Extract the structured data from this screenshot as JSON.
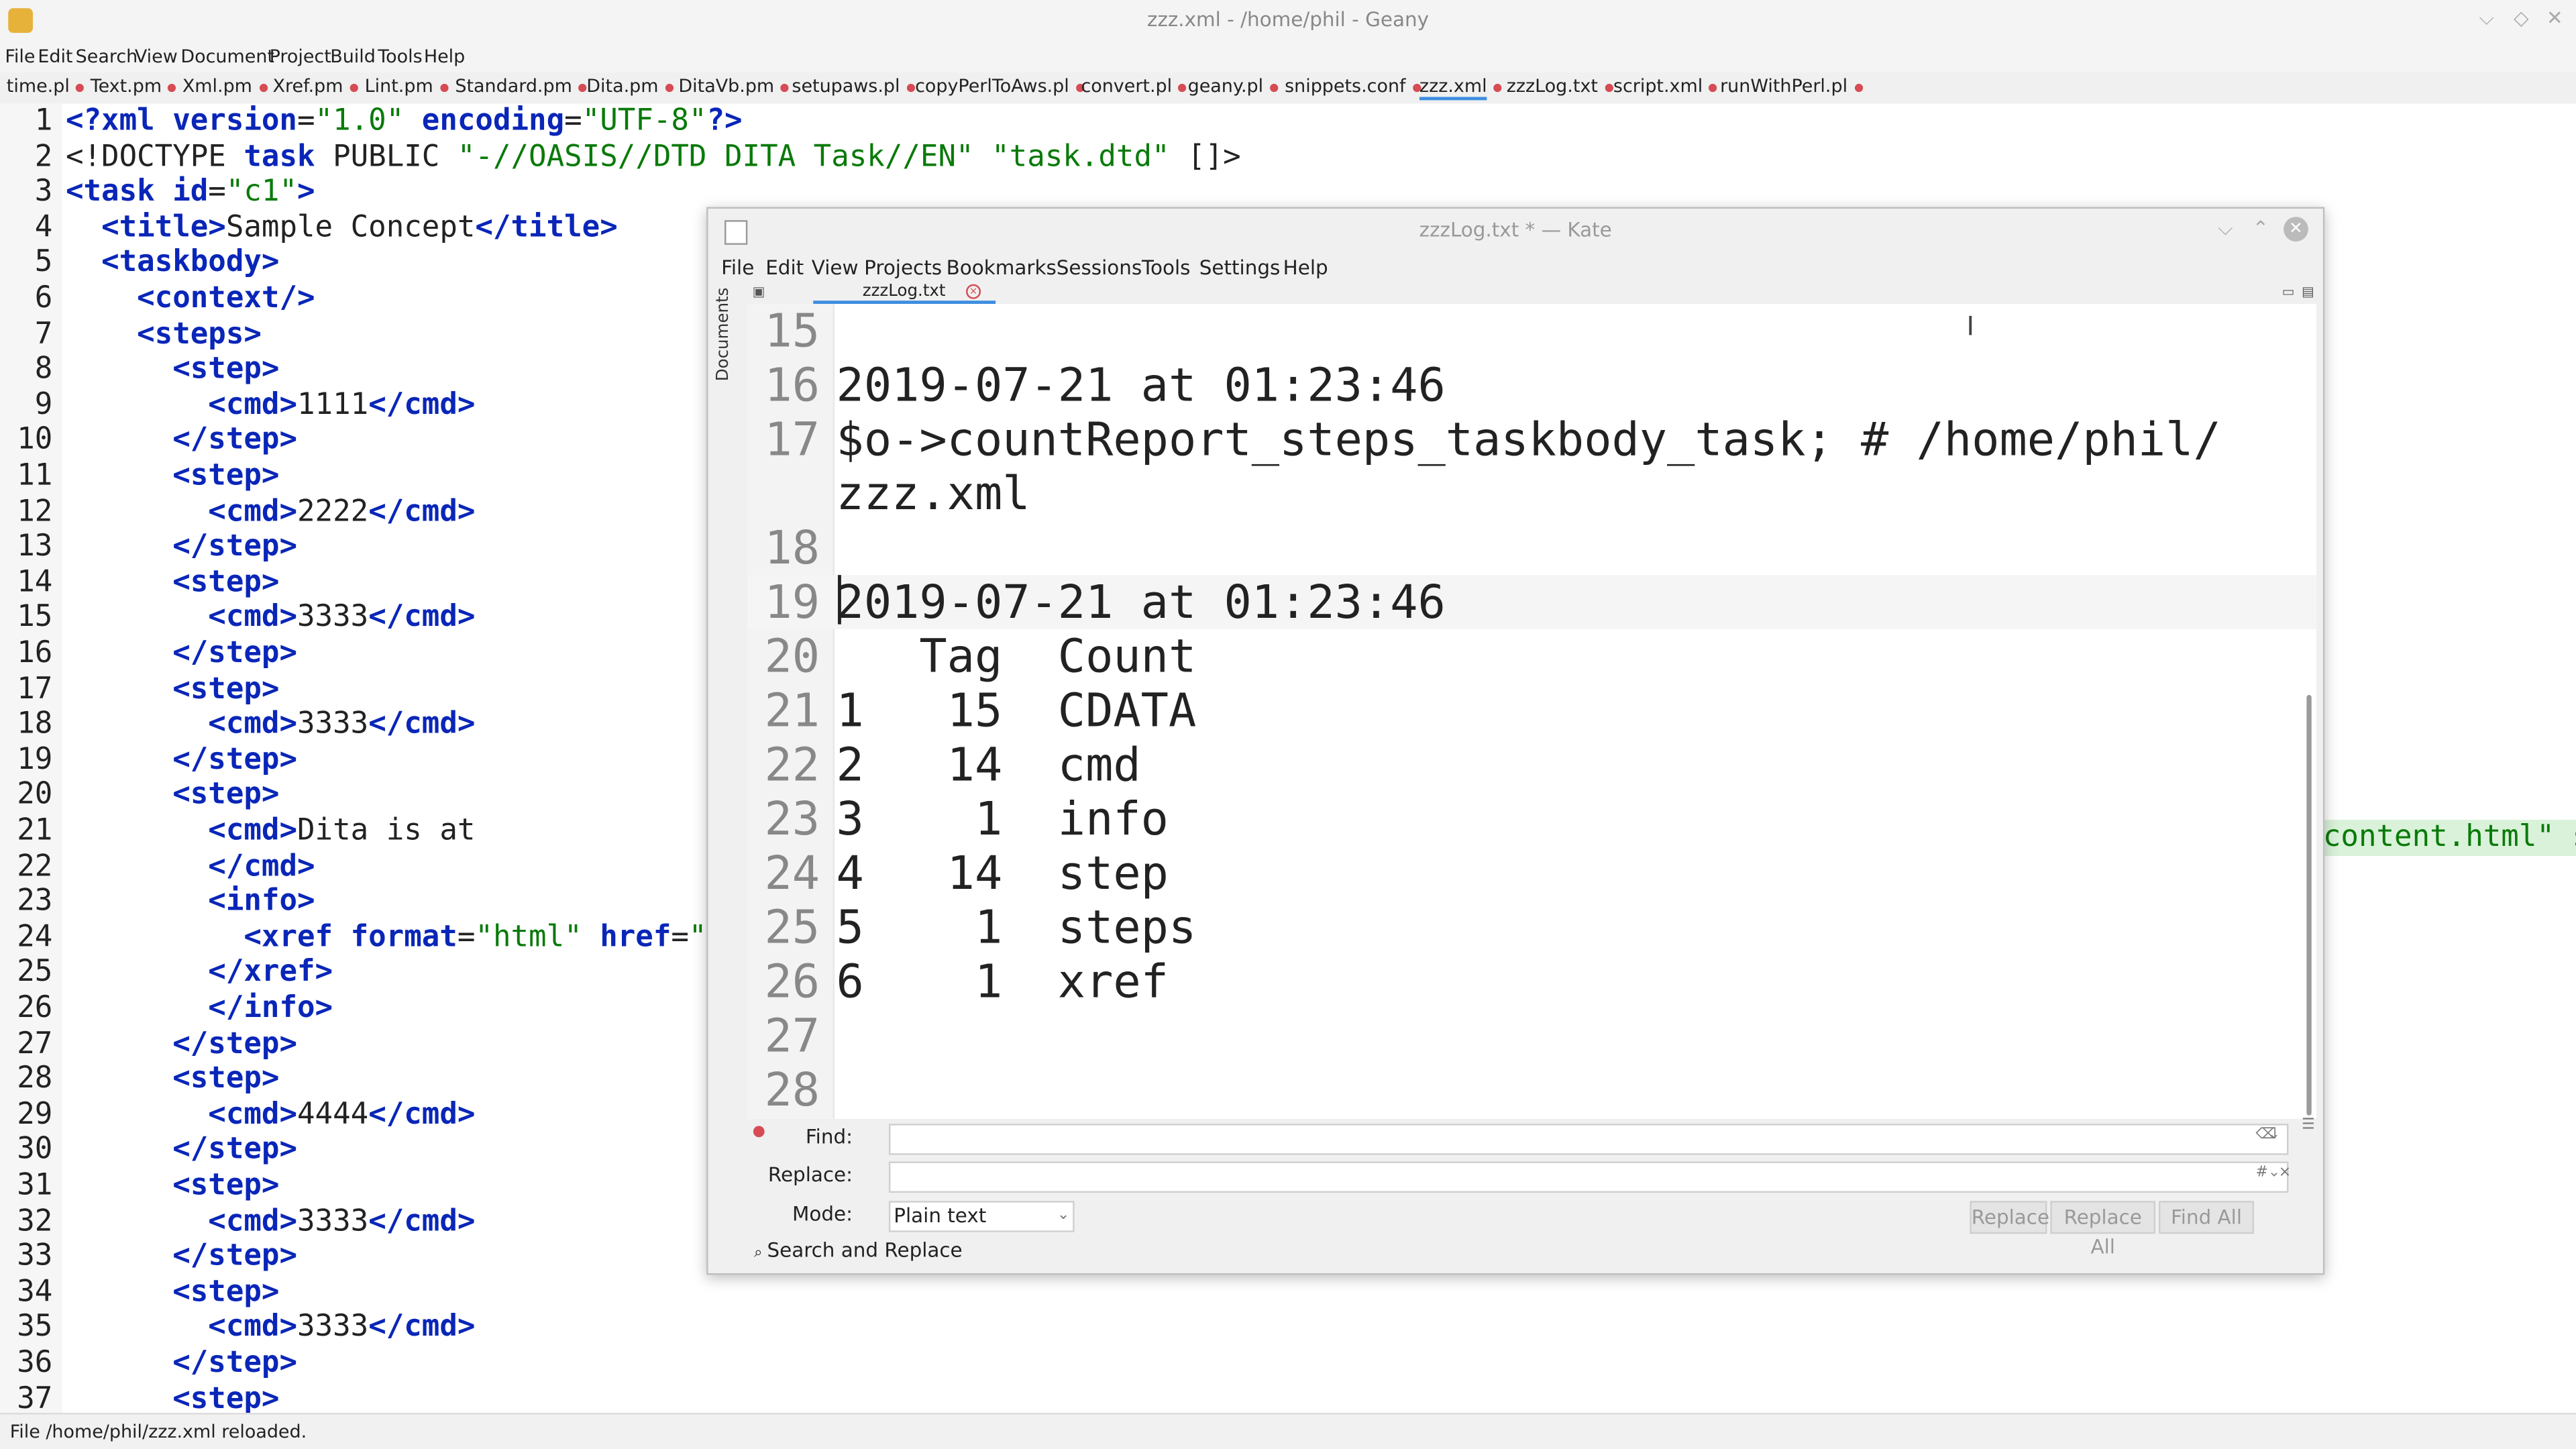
{
  "geany": {
    "title": "zzz.xml - /home/phil - Geany",
    "menu": [
      "File",
      "Edit",
      "Search",
      "View",
      "Document",
      "Project",
      "Build",
      "Tools",
      "Help"
    ],
    "tabs": [
      "time.pl",
      "Text.pm",
      "Xml.pm",
      "Xref.pm",
      "Lint.pm",
      "Standard.pm",
      "Dita.pm",
      "DitaVb.pm",
      "setupaws.pl",
      "copyPerlToAws.pl",
      "convert.pl",
      "geany.pl",
      "snippets.conf",
      "zzz.xml",
      "zzzLog.txt",
      "script.xml",
      "runWithPerl.pl"
    ],
    "active_tab": "zzz.xml",
    "right_fragment": "content.html\" s",
    "status": "File /home/phil/zzz.xml reloaded."
  },
  "kate": {
    "title": "zzzLog.txt * — Kate",
    "menu": [
      "File",
      "Edit",
      "View",
      "Projects",
      "Bookmarks",
      "Sessions",
      "Tools",
      "Settings",
      "Help"
    ],
    "sidebar_label": "Documents",
    "tab": "zzzLog.txt",
    "find_label": "Find:",
    "replace_label": "Replace:",
    "mode_label": "Mode:",
    "mode_value": "Plain text",
    "buttons": [
      "Replace",
      "Replace All",
      "Find All"
    ],
    "panel_title": "Search and Replace"
  },
  "kate_lines": [
    {
      "n": "15",
      "t": ""
    },
    {
      "n": "16",
      "t": "2019-07-21 at 01:23:46"
    },
    {
      "n": "17",
      "t": "$o->countReport_steps_taskbody_task; # /home/phil/"
    },
    {
      "n": "",
      "t": "zzz.xml"
    },
    {
      "n": "18",
      "t": ""
    },
    {
      "n": "19",
      "t": "2019-07-21 at 01:23:46"
    },
    {
      "n": "20",
      "t": "   Tag  Count"
    },
    {
      "n": "21",
      "t": "1   15  CDATA"
    },
    {
      "n": "22",
      "t": "2   14  cmd"
    },
    {
      "n": "23",
      "t": "3    1  info"
    },
    {
      "n": "24",
      "t": "4   14  step"
    },
    {
      "n": "25",
      "t": "5    1  steps"
    },
    {
      "n": "26",
      "t": "6    1  xref"
    },
    {
      "n": "27",
      "t": ""
    },
    {
      "n": "28",
      "t": ""
    }
  ],
  "geany_lines": [
    {
      "n": "1",
      "segs": [
        [
          "t",
          "<?xml version"
        ],
        [
          "p",
          "="
        ],
        [
          "v",
          "\"1.0\""
        ],
        [
          "t",
          " encoding"
        ],
        [
          "p",
          "="
        ],
        [
          "v",
          "\"UTF-8\""
        ],
        [
          "t",
          "?>"
        ]
      ]
    },
    {
      "n": "2",
      "segs": [
        [
          "p",
          "<!DOCTYPE "
        ],
        [
          "t",
          "task"
        ],
        [
          "p",
          " PUBLIC "
        ],
        [
          "v",
          "\"-//OASIS//DTD DITA Task//EN\""
        ],
        [
          "p",
          " "
        ],
        [
          "v",
          "\"task.dtd\""
        ],
        [
          "p",
          " []>"
        ]
      ]
    },
    {
      "n": "3",
      "segs": [
        [
          "t",
          "<task id"
        ],
        [
          "p",
          "="
        ],
        [
          "v",
          "\"c1\""
        ],
        [
          "t",
          ">"
        ]
      ]
    },
    {
      "n": "4",
      "segs": [
        [
          "p",
          "  "
        ],
        [
          "t",
          "<title>"
        ],
        [
          "p",
          "Sample Concept"
        ],
        [
          "t",
          "</title>"
        ]
      ]
    },
    {
      "n": "5",
      "segs": [
        [
          "p",
          "  "
        ],
        [
          "t",
          "<taskbody>"
        ]
      ]
    },
    {
      "n": "6",
      "segs": [
        [
          "p",
          "    "
        ],
        [
          "t",
          "<context/>"
        ]
      ]
    },
    {
      "n": "7",
      "segs": [
        [
          "p",
          "    "
        ],
        [
          "t",
          "<steps>"
        ]
      ]
    },
    {
      "n": "8",
      "segs": [
        [
          "p",
          "      "
        ],
        [
          "t",
          "<step>"
        ]
      ]
    },
    {
      "n": "9",
      "segs": [
        [
          "p",
          "        "
        ],
        [
          "t",
          "<cmd>"
        ],
        [
          "p",
          "1111"
        ],
        [
          "t",
          "</cmd>"
        ]
      ]
    },
    {
      "n": "10",
      "segs": [
        [
          "p",
          "      "
        ],
        [
          "t",
          "</step>"
        ]
      ]
    },
    {
      "n": "11",
      "segs": [
        [
          "p",
          "      "
        ],
        [
          "t",
          "<step>"
        ]
      ]
    },
    {
      "n": "12",
      "segs": [
        [
          "p",
          "        "
        ],
        [
          "t",
          "<cmd>"
        ],
        [
          "p",
          "2222"
        ],
        [
          "t",
          "</cmd>"
        ]
      ]
    },
    {
      "n": "13",
      "segs": [
        [
          "p",
          "      "
        ],
        [
          "t",
          "</step>"
        ]
      ]
    },
    {
      "n": "14",
      "segs": [
        [
          "p",
          "      "
        ],
        [
          "t",
          "<step>"
        ]
      ]
    },
    {
      "n": "15",
      "segs": [
        [
          "p",
          "        "
        ],
        [
          "t",
          "<cmd>"
        ],
        [
          "p",
          "3333"
        ],
        [
          "t",
          "</cmd>"
        ]
      ]
    },
    {
      "n": "16",
      "segs": [
        [
          "p",
          "      "
        ],
        [
          "t",
          "</step>"
        ]
      ]
    },
    {
      "n": "17",
      "segs": [
        [
          "p",
          "      "
        ],
        [
          "t",
          "<step>"
        ]
      ]
    },
    {
      "n": "18",
      "segs": [
        [
          "p",
          "        "
        ],
        [
          "t",
          "<cmd>"
        ],
        [
          "p",
          "3333"
        ],
        [
          "t",
          "</cmd>"
        ]
      ]
    },
    {
      "n": "19",
      "segs": [
        [
          "p",
          "      "
        ],
        [
          "t",
          "</step>"
        ]
      ]
    },
    {
      "n": "20",
      "segs": [
        [
          "p",
          "      "
        ],
        [
          "t",
          "<step>"
        ]
      ]
    },
    {
      "n": "21",
      "segs": [
        [
          "p",
          "        "
        ],
        [
          "t",
          "<cmd>"
        ],
        [
          "p",
          "Dita is at"
        ]
      ]
    },
    {
      "n": "22",
      "segs": [
        [
          "p",
          "        "
        ],
        [
          "t",
          "</cmd>"
        ]
      ]
    },
    {
      "n": "23",
      "segs": [
        [
          "p",
          "        "
        ],
        [
          "t",
          "<info>"
        ]
      ]
    },
    {
      "n": "24",
      "segs": [
        [
          "p",
          "          "
        ],
        [
          "t",
          "<xref format"
        ],
        [
          "p",
          "="
        ],
        [
          "v",
          "\"html\""
        ],
        [
          "t",
          " href"
        ],
        [
          "p",
          "="
        ],
        [
          "v",
          "\""
        ]
      ]
    },
    {
      "n": "25",
      "segs": [
        [
          "p",
          "        "
        ],
        [
          "t",
          "</xref>"
        ]
      ]
    },
    {
      "n": "26",
      "segs": [
        [
          "p",
          "        "
        ],
        [
          "t",
          "</info>"
        ]
      ]
    },
    {
      "n": "27",
      "segs": [
        [
          "p",
          "      "
        ],
        [
          "t",
          "</step>"
        ]
      ]
    },
    {
      "n": "28",
      "segs": [
        [
          "p",
          "      "
        ],
        [
          "t",
          "<step>"
        ]
      ]
    },
    {
      "n": "29",
      "segs": [
        [
          "p",
          "        "
        ],
        [
          "t",
          "<cmd>"
        ],
        [
          "p",
          "4444"
        ],
        [
          "t",
          "</cmd>"
        ]
      ]
    },
    {
      "n": "30",
      "segs": [
        [
          "p",
          "      "
        ],
        [
          "t",
          "</step>"
        ]
      ]
    },
    {
      "n": "31",
      "segs": [
        [
          "p",
          "      "
        ],
        [
          "t",
          "<step>"
        ]
      ]
    },
    {
      "n": "32",
      "segs": [
        [
          "p",
          "        "
        ],
        [
          "t",
          "<cmd>"
        ],
        [
          "p",
          "3333"
        ],
        [
          "t",
          "</cmd>"
        ]
      ]
    },
    {
      "n": "33",
      "segs": [
        [
          "p",
          "      "
        ],
        [
          "t",
          "</step>"
        ]
      ]
    },
    {
      "n": "34",
      "segs": [
        [
          "p",
          "      "
        ],
        [
          "t",
          "<step>"
        ]
      ]
    },
    {
      "n": "35",
      "segs": [
        [
          "p",
          "        "
        ],
        [
          "t",
          "<cmd>"
        ],
        [
          "p",
          "3333"
        ],
        [
          "t",
          "</cmd>"
        ]
      ]
    },
    {
      "n": "36",
      "segs": [
        [
          "p",
          "      "
        ],
        [
          "t",
          "</step>"
        ]
      ]
    },
    {
      "n": "37",
      "segs": [
        [
          "p",
          "      "
        ],
        [
          "t",
          "<step>"
        ]
      ]
    }
  ],
  "colors": {
    "tag": "#0a26b8",
    "string": "#0a7a0a",
    "accent": "#3d8ee0",
    "modified_dot": "#d64b54"
  }
}
